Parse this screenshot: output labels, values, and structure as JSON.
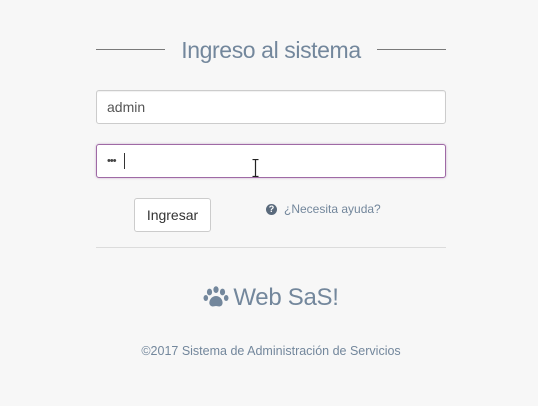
{
  "login": {
    "title": "Ingreso al sistema",
    "username_value": "admin",
    "password_value": "•••",
    "submit_label": "Ingresar",
    "help_icon_glyph": "?",
    "help_link": "¿Necesita ayuda?"
  },
  "brand": {
    "name": "Web SaS!",
    "icon": "paw-icon"
  },
  "footer": {
    "text": "©2017 Sistema de Administración de Servicios"
  },
  "colors": {
    "text_muted": "#73879c",
    "focus_border": "#9f6aa5",
    "background": "#f7f7f7"
  }
}
